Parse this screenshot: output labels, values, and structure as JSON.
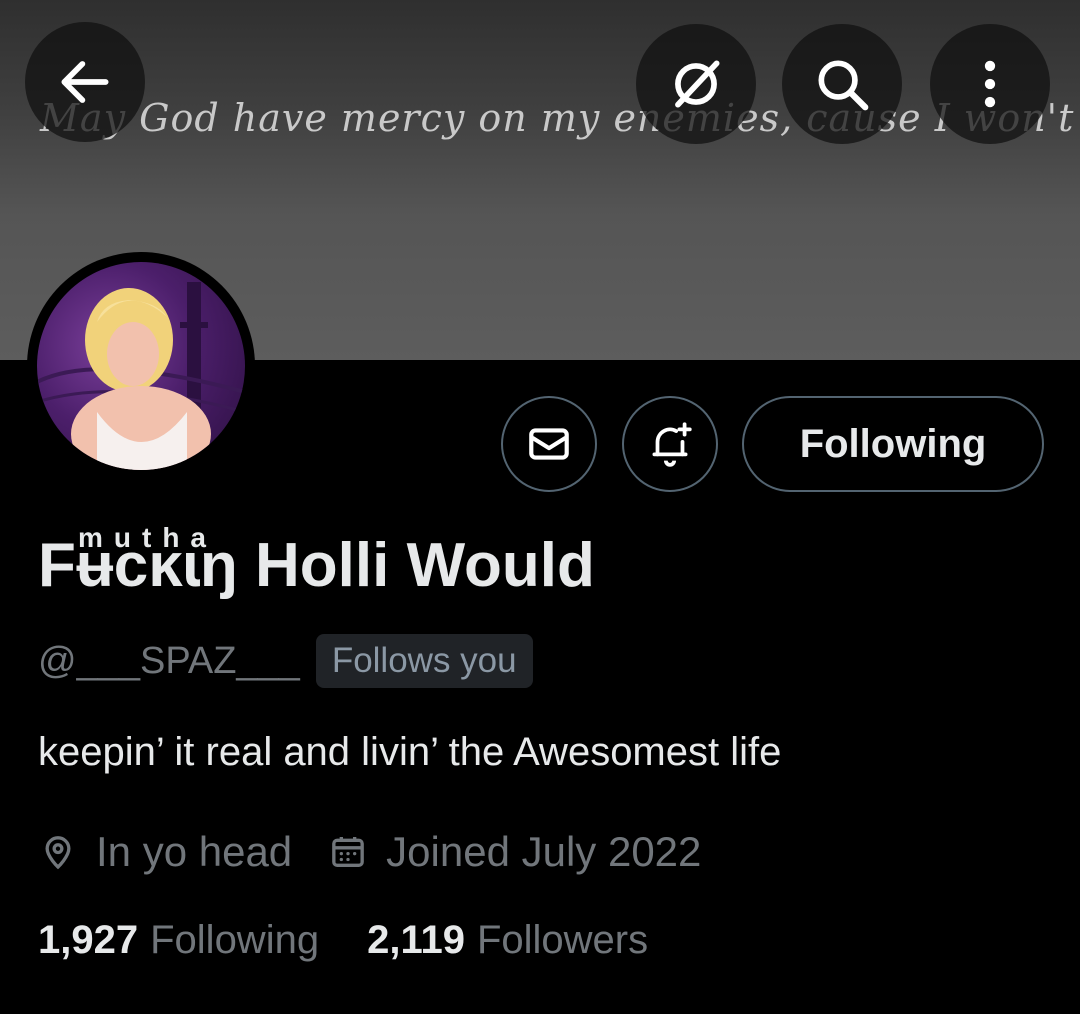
{
  "banner": {
    "text": "May God have mercy on my enemies, cause I won't"
  },
  "top_actions": {
    "back_icon": "arrow-left-icon",
    "grok_icon": "grok-icon",
    "search_icon": "search-icon",
    "more_icon": "more-vertical-icon"
  },
  "profile": {
    "name_superscript": "mutha",
    "display_name": "Fʉcĸɩŋ Holli Would",
    "handle": "@___SPAZ___",
    "follows_you_badge": "Follows you",
    "bio": "keepin’ it real and livin’ the Awesomest life",
    "location": "In yo head",
    "joined": "Joined July 2022"
  },
  "actions": {
    "message_icon": "envelope-icon",
    "notify_icon": "bell-plus-icon",
    "following_label": "Following"
  },
  "stats": {
    "following_count": "1,927",
    "following_label": "Following",
    "followers_count": "2,119",
    "followers_label": "Followers"
  },
  "colors": {
    "background": "#000000",
    "text_primary": "#e7e9ea",
    "text_secondary": "#71767b",
    "border": "#536471",
    "badge_bg": "#202327"
  }
}
